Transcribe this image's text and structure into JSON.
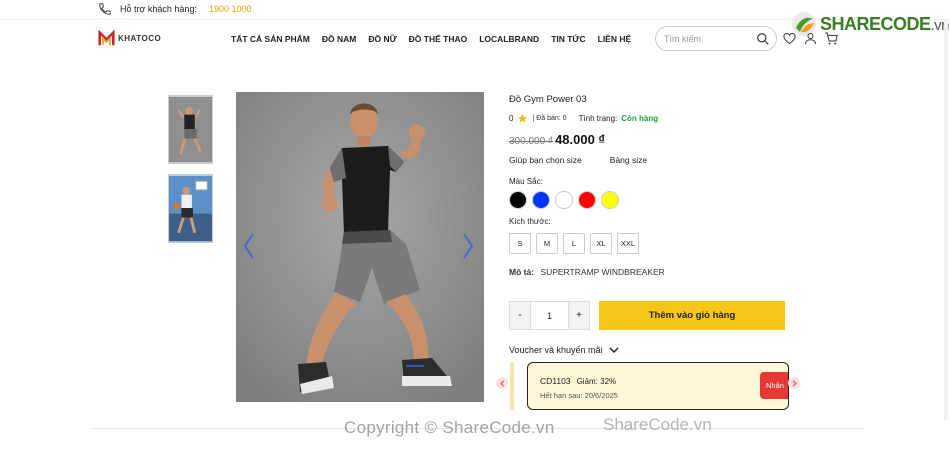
{
  "support": {
    "label": "Hỗ trợ khách hàng:",
    "hotline": "1900 1000"
  },
  "brand": {
    "name": "KHATOCO"
  },
  "watermark": {
    "site_main": "SHARECODE",
    "site_ext": ".vn",
    "copyright": "Copyright © ShareCode.vn",
    "copyright_overlay": "ShareCode.vn"
  },
  "nav": {
    "items": [
      "TẤT CẢ SẢN PHẨM",
      "ĐỒ NAM",
      "ĐỒ NỮ",
      "ĐỒ THỂ THAO",
      "LOCALBRAND",
      "TIN TỨC",
      "LIÊN HỆ"
    ]
  },
  "search": {
    "placeholder": "Tìm kiếm",
    "value": ""
  },
  "header_icons": [
    "heart-icon",
    "user-icon",
    "cart-icon"
  ],
  "product": {
    "title": "Đồ Gym Power 03",
    "rating": "0",
    "sold": "| Đã bán: 0",
    "status_label": "Tình trạng:",
    "status_value": "Còn hàng",
    "old_price": "300.000 ₫",
    "new_price": "48.000 ₫",
    "size_help": "Giúp bạn chọn size",
    "size_chart": "Bảng size",
    "color_label": "Màu Sắc:",
    "colors": [
      "#000000",
      "#0033ff",
      "#ffffff",
      "#ff0000",
      "#ffff00"
    ],
    "size_label": "Kích thước:",
    "sizes": [
      "S",
      "M",
      "L",
      "XL",
      "XXL"
    ],
    "desc_label": "Mô tả:",
    "desc_value": "SUPERTRAMP WINDBREAKER",
    "qty_minus": "-",
    "qty_value": "1",
    "qty_plus": "+",
    "add_to_cart": "Thêm vào giỏ hàng"
  },
  "voucher": {
    "title": "Voucher và khuyến mãi",
    "code": "CD1103",
    "discount": "Giảm: 32%",
    "expiry": "Hết hạn sau: 20/6/2025",
    "get_label": "Nhận"
  },
  "colors": {
    "accent": "#f5c518",
    "hotline": "#e0a100",
    "in_stock": "#1e9e3c",
    "voucher_btn": "#e53935"
  }
}
